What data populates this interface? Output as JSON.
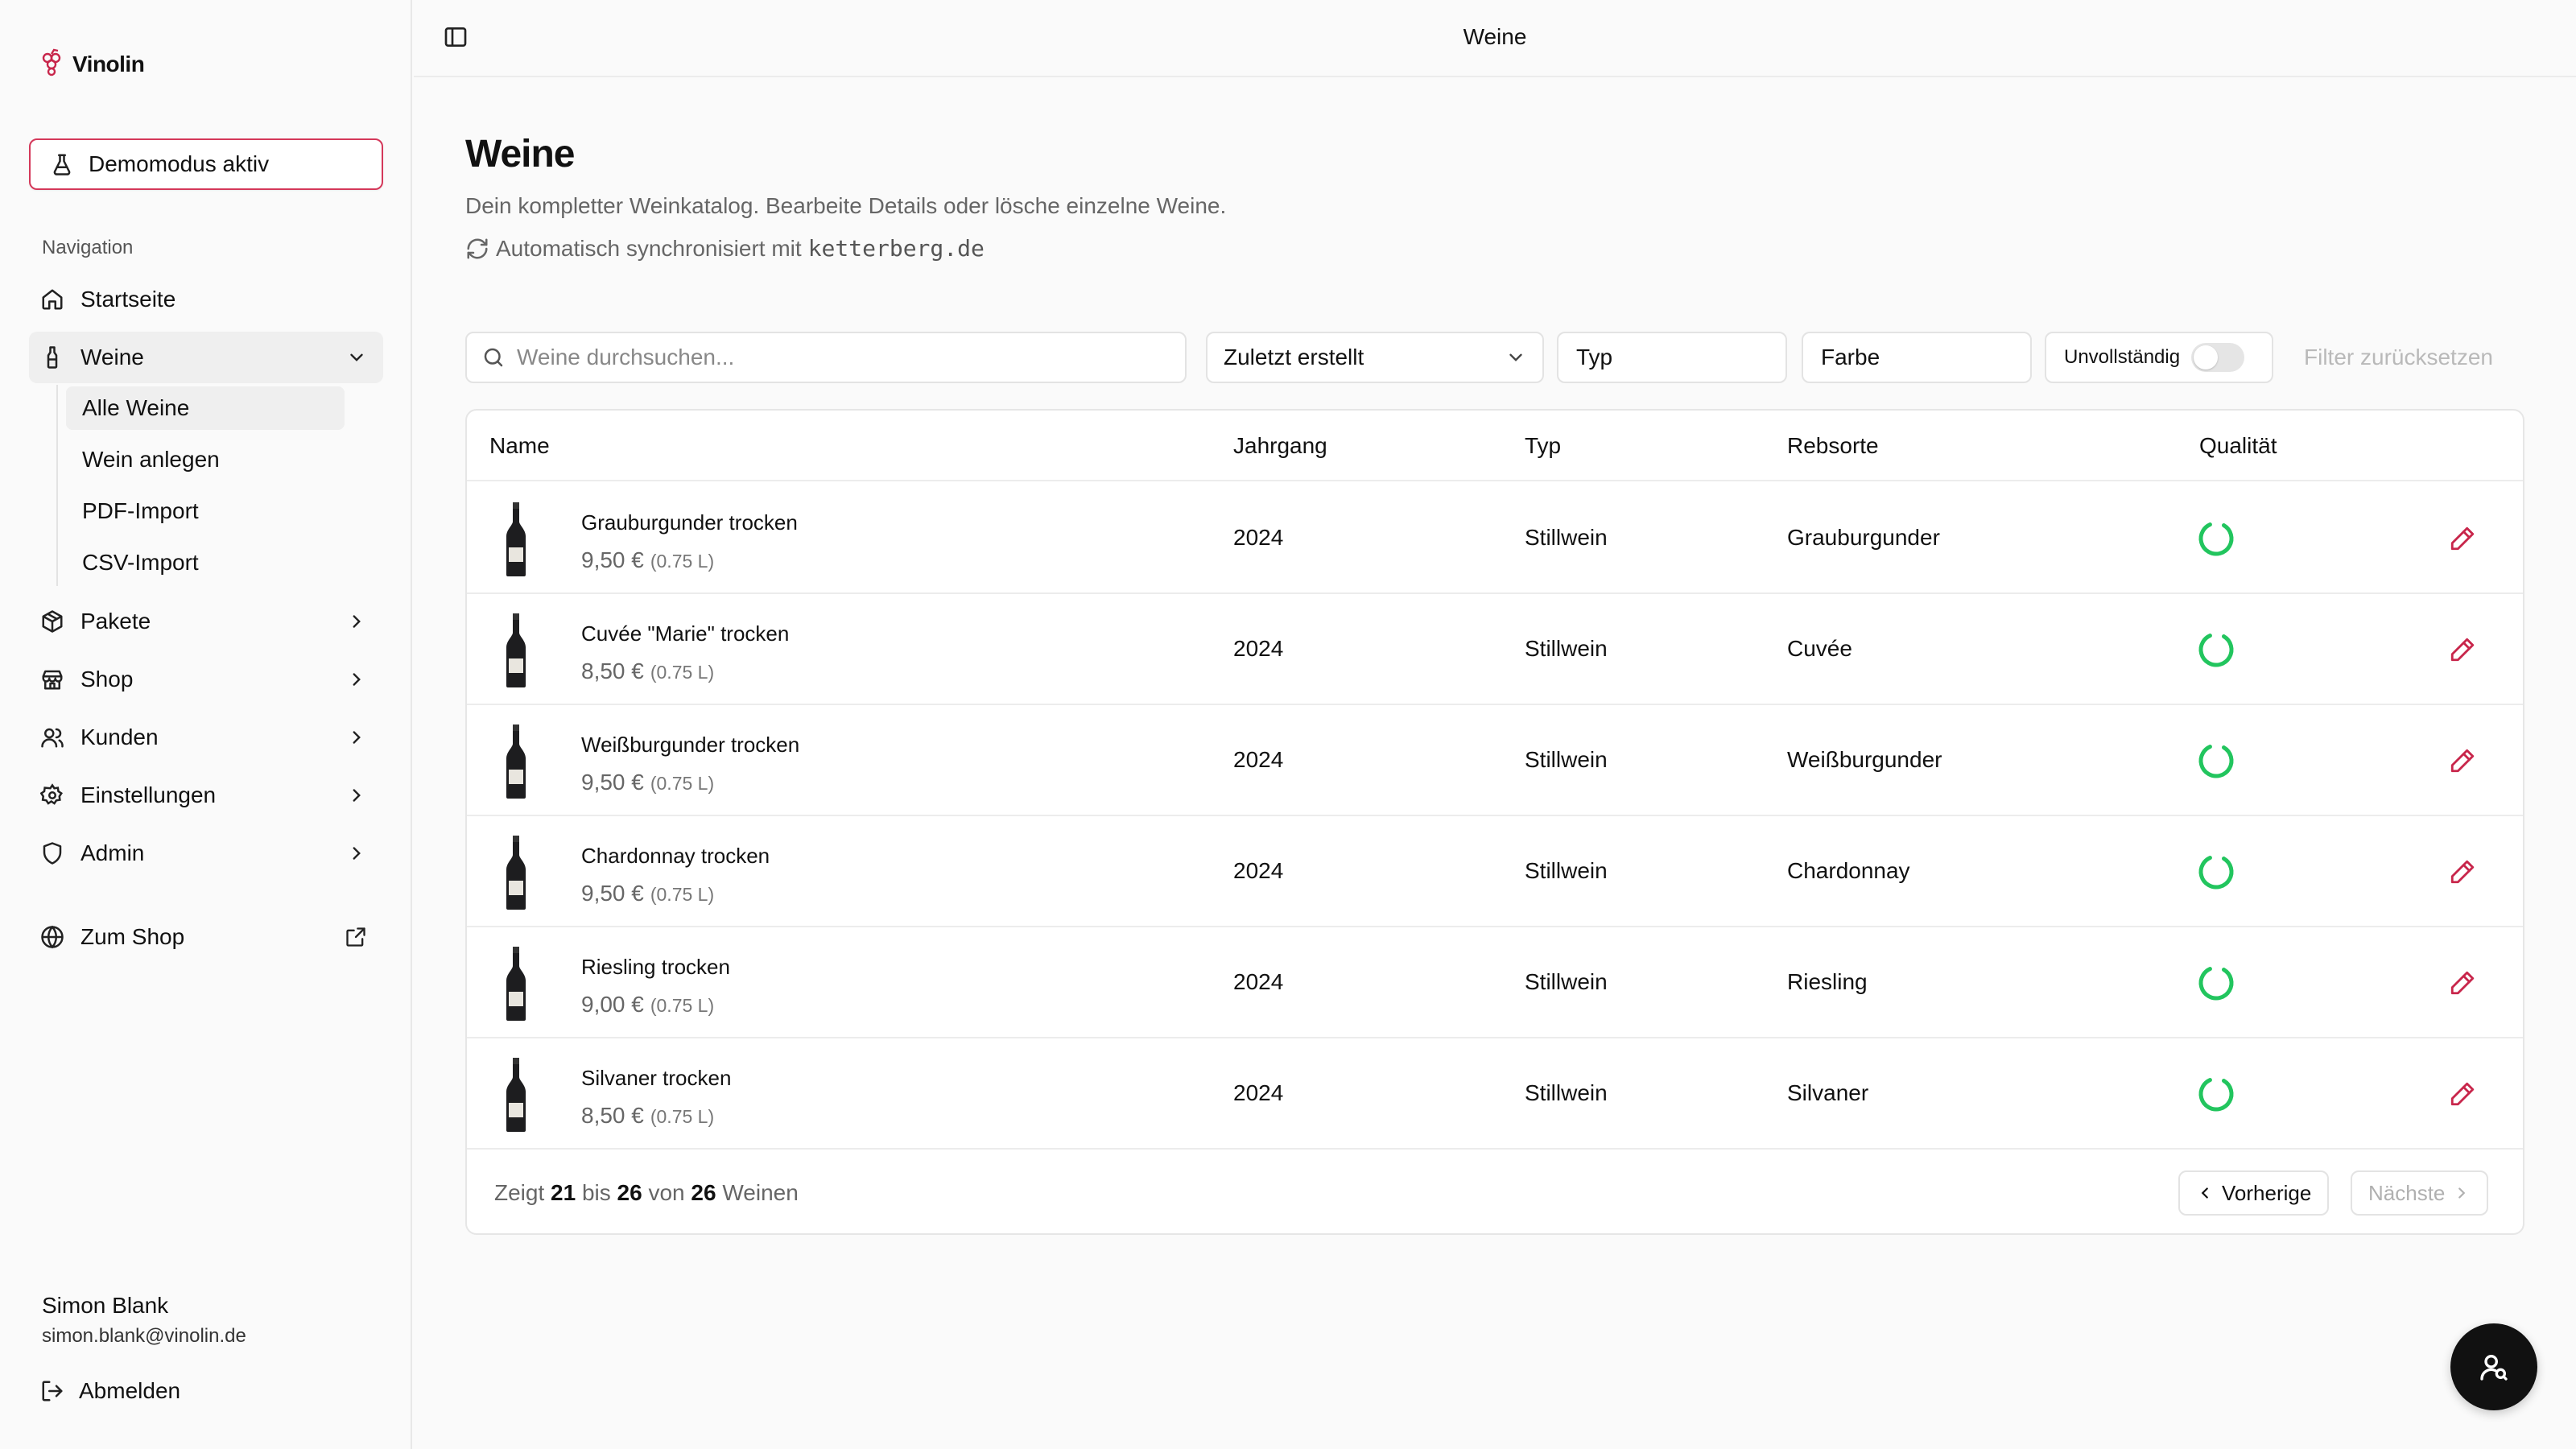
{
  "app": {
    "name": "Vinolin",
    "brand_color": "#c8264b"
  },
  "sidebar": {
    "demo_label": "Demomodus aktiv",
    "section_label": "Navigation",
    "items": [
      {
        "label": "Startseite",
        "icon": "home-icon"
      },
      {
        "label": "Weine",
        "icon": "wine-icon",
        "expanded": true
      },
      {
        "label": "Pakete",
        "icon": "package-icon"
      },
      {
        "label": "Shop",
        "icon": "store-icon"
      },
      {
        "label": "Kunden",
        "icon": "users-icon"
      },
      {
        "label": "Einstellungen",
        "icon": "gear-icon"
      },
      {
        "label": "Admin",
        "icon": "shield-icon"
      }
    ],
    "sub_items": [
      {
        "label": "Alle Weine",
        "active": true
      },
      {
        "label": "Wein anlegen"
      },
      {
        "label": "PDF-Import"
      },
      {
        "label": "CSV-Import"
      }
    ],
    "shop_link": "Zum Shop",
    "user": {
      "name": "Simon Blank",
      "email": "simon.blank@vinolin.de"
    },
    "logout": "Abmelden"
  },
  "topbar": {
    "title": "Weine"
  },
  "page": {
    "title": "Weine",
    "description": "Dein kompletter Weinkatalog. Bearbeite Details oder lösche einzelne Weine.",
    "sync_text": "Automatisch synchronisiert mit",
    "sync_domain": "ketterberg.de"
  },
  "filters": {
    "search_placeholder": "Weine durchsuchen...",
    "sort": "Zuletzt erstellt",
    "type": "Typ",
    "color": "Farbe",
    "incomplete": "Unvollständig",
    "incomplete_on": false,
    "reset": "Filter zurücksetzen"
  },
  "table": {
    "columns": [
      "Name",
      "Jahrgang",
      "Typ",
      "Rebsorte",
      "Qualität"
    ],
    "rows": [
      {
        "name": "Grauburgunder trocken",
        "price": "9,50 €",
        "volume": "(0.75 L)",
        "year": "2024",
        "type": "Stillwein",
        "grape": "Grauburgunder",
        "quality": 0.85
      },
      {
        "name": "Cuvée \"Marie\" trocken",
        "price": "8,50 €",
        "volume": "(0.75 L)",
        "year": "2024",
        "type": "Stillwein",
        "grape": "Cuvée",
        "quality": 0.85
      },
      {
        "name": "Weißburgunder trocken",
        "price": "9,50 €",
        "volume": "(0.75 L)",
        "year": "2024",
        "type": "Stillwein",
        "grape": "Weißburgunder",
        "quality": 0.85
      },
      {
        "name": "Chardonnay trocken",
        "price": "9,50 €",
        "volume": "(0.75 L)",
        "year": "2024",
        "type": "Stillwein",
        "grape": "Chardonnay",
        "quality": 0.85
      },
      {
        "name": "Riesling trocken",
        "price": "9,00 €",
        "volume": "(0.75 L)",
        "year": "2024",
        "type": "Stillwein",
        "grape": "Riesling",
        "quality": 0.85
      },
      {
        "name": "Silvaner trocken",
        "price": "8,50 €",
        "volume": "(0.75 L)",
        "year": "2024",
        "type": "Stillwein",
        "grape": "Silvaner",
        "quality": 0.85
      }
    ]
  },
  "pagination": {
    "prefix": "Zeigt",
    "from": "21",
    "mid1": "bis",
    "to": "26",
    "mid2": "von",
    "total": "26",
    "suffix": "Weinen",
    "prev": "Vorherige",
    "next": "Nächste"
  },
  "colors": {
    "quality": "#22c55e",
    "edit": "#c8264b"
  }
}
